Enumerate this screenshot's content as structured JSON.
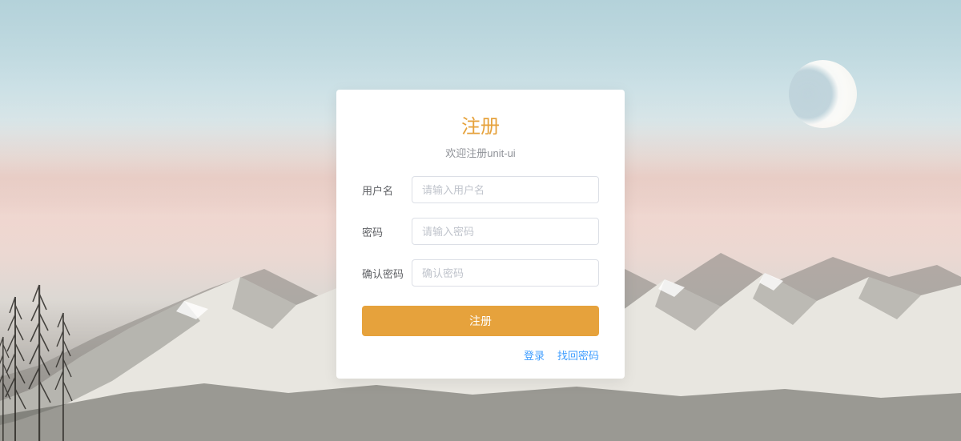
{
  "form": {
    "title": "注册",
    "subtitle": "欢迎注册unit-ui",
    "fields": {
      "username": {
        "label": "用户名",
        "placeholder": "请输入用户名",
        "value": ""
      },
      "password": {
        "label": "密码",
        "placeholder": "请输入密码",
        "value": ""
      },
      "confirm": {
        "label": "确认密码",
        "placeholder": "确认密码",
        "value": ""
      }
    },
    "submit_label": "注册",
    "links": {
      "login": "登录",
      "recover": "找回密码"
    }
  },
  "colors": {
    "accent": "#e6a23c",
    "link": "#409eff",
    "text_secondary": "#909399",
    "border": "#dcdfe6"
  }
}
